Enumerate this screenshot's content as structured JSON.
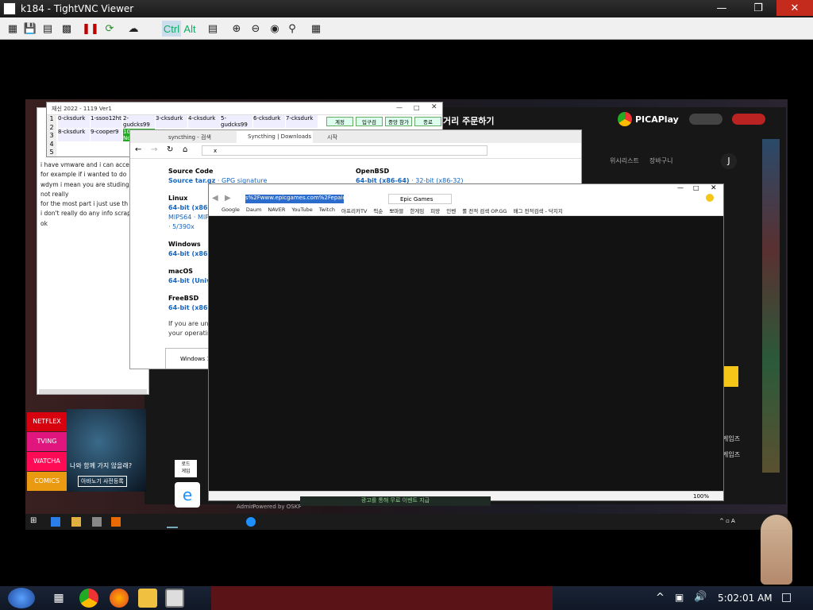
{
  "viewer": {
    "title": "k184 - TightVNC Viewer",
    "toolbar": {
      "ctrl_label": "Ctrl",
      "alt_label": "Alt"
    }
  },
  "remote": {
    "sheet_window": {
      "title": "재신 2022 - 1119 Ver1",
      "tabs": [
        "계정",
        "입구검",
        "중앙 참가",
        "종료"
      ],
      "row_numbers": [
        "1",
        "2",
        "3",
        "4",
        "5"
      ],
      "cells": [
        "0-cksdurk",
        "1-ssoo12ht",
        "2-gudcks99",
        "3-cksdurk",
        "4-cksdurk",
        "5-gudcks99",
        "6-cksdurk",
        "7-cksdurk",
        "8-cksdurk",
        "9-cooper9",
        "10-Notenou"
      ]
    },
    "chat_lines": [
      "i have vmware and i can acce...",
      "for example if i wanted to do",
      "wdym i mean you are studing",
      "not really",
      "for the most part i just use th",
      "i don't really do any info scrap",
      "ok"
    ],
    "browser_syncthing": {
      "tab1": "syncthing - 검색",
      "tab2": "Syncthing | Downloads",
      "tab3": "시작",
      "address": "x",
      "sections": [
        {
          "heading": "Source Code",
          "link": "Source tar.gz",
          "extra": " · GPG signature"
        },
        {
          "heading": "Linux",
          "link": "64-bit (x86-6",
          "extra": ""
        },
        {
          "heading": "Windows",
          "link": "64-bit (x86-6",
          "extra": ""
        },
        {
          "heading": "macOS",
          "link": "64-bit (Unive",
          "extra": ""
        },
        {
          "heading": "FreeBSD",
          "link": "64-bit (x86-6",
          "extra": ""
        }
      ],
      "linux_extra1": "MIPS64 · MIP",
      "linux_extra2": "· 5/390x",
      "openbsd_heading": "OpenBSD",
      "openbsd_link": "64-bit (x86-64)",
      "openbsd_extra": " · 32-bit (x86-32)",
      "note1": "If you are uns",
      "note2": "your operatin",
      "windows_button": "Windows 1"
    },
    "browser_epic": {
      "address": "s%2Fwww.epicgames.com%2Fepaid%2Fidentity",
      "tab": "Epic Games",
      "bookmarks": [
        "Google",
        "Daum",
        "NAVER",
        "YouTube",
        "Twitch",
        "아프리카TV",
        "픽순",
        "뽀마블",
        "한게임",
        "피망",
        "인벤",
        "롤 전적 검색 OP.GG",
        "배그 전적검색 - 닥지지"
      ],
      "zoom": "100%"
    },
    "picaplay": {
      "brand": "PICAPlay",
      "order_text": "거리 주문하기",
      "user_initial": "J",
      "nav": [
        "위시리스트",
        "장바구니"
      ],
      "side_text": [
        "게임즈",
        "게임즈"
      ]
    },
    "streaming_buttons": [
      "NETFLEX",
      "TVING",
      "WATCHA",
      "COMICS"
    ],
    "ad_text": "나와 함께 가지 않을래?",
    "ad_button": "아바노기 사전등록",
    "admin_text": "Admin",
    "powered_text": "Powered by OSKP",
    "banner_text": "광고를 통해 무료 이벤트 지급",
    "game_label": "로드\n게임"
  },
  "taskbar": {
    "clock": "5:02:01 AM"
  },
  "colors": {
    "netflix": "#d6000f",
    "tving": "#e0167e",
    "watcha": "#ff0b55",
    "comics": "#e99a10",
    "link_blue": "#1565c0",
    "picaplay_yellow": "#f5c518"
  }
}
